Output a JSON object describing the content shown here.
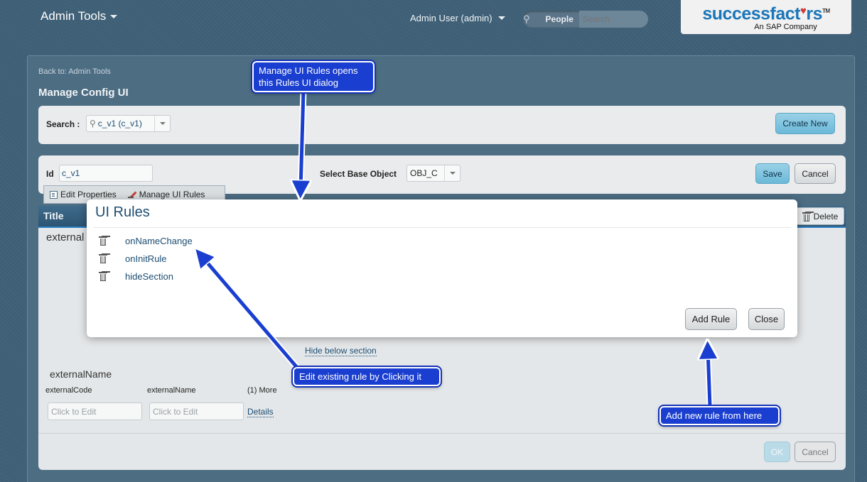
{
  "topbar": {
    "app_title": "Admin Tools",
    "user_menu": "Admin User (admin)",
    "search_scope": "People",
    "search_placeholder": "Search"
  },
  "logo": {
    "main_text_a": "successfact",
    "main_text_b": "rs",
    "trademark": "TM",
    "subtitle": "An SAP Company"
  },
  "page": {
    "back_link": "Back to: Admin Tools",
    "title": "Manage Config UI"
  },
  "search": {
    "label": "Search :",
    "value": "c_v1 (c_v1)",
    "create_new": "Create New"
  },
  "object_bar": {
    "id_label": "Id",
    "id_value": "c_v1",
    "base_label": "Select Base Object",
    "base_value": "OBJ_C",
    "save": "Save",
    "cancel": "Cancel"
  },
  "tabs": [
    {
      "label": "Edit Properties"
    },
    {
      "label": "Manage UI Rules"
    }
  ],
  "section": {
    "header_title": "Title",
    "delete": "Delete",
    "side_label": "external",
    "hide_link": "Hide below section",
    "field_label": "externalName",
    "columns": [
      "externalCode",
      "externalName",
      "(1) More"
    ],
    "edit_placeholder": "Click to Edit",
    "details": "Details",
    "ok": "OK",
    "cancel": "Cancel"
  },
  "modal": {
    "title": "UI Rules",
    "rules": [
      {
        "name": "onNameChange"
      },
      {
        "name": "onInitRule"
      },
      {
        "name": "hideSection"
      }
    ],
    "add_rule": "Add Rule",
    "close": "Close"
  },
  "callouts": {
    "open_dialog": "Manage UI Rules opens this Rules UI dialog",
    "edit_rule": "Edit existing rule by Clicking it",
    "add_rule": "Add new rule from here"
  },
  "colors": {
    "background": "#3f6077",
    "callout": "#1a3fd0",
    "accent_button": "#6bb9d9",
    "link": "#1b4d72"
  }
}
